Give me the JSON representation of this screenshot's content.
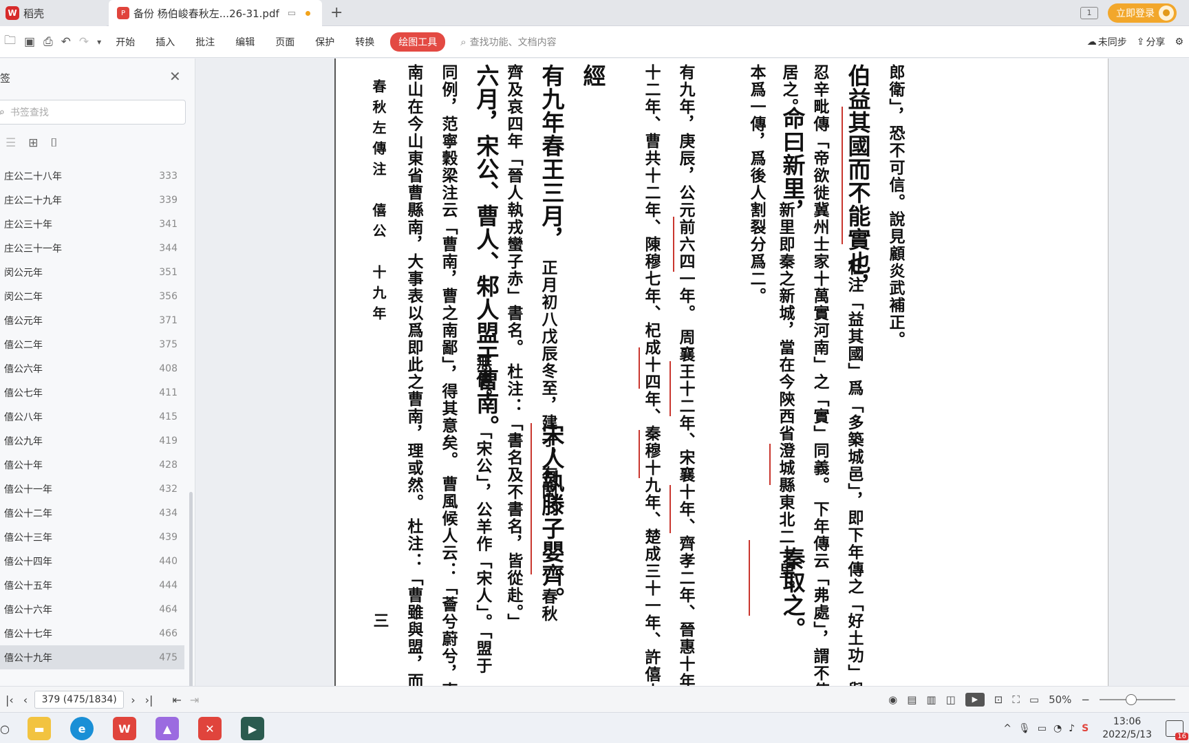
{
  "tabs": {
    "home": "稻壳",
    "doc": "备份 杨伯峻春秋左...26-31.pdf"
  },
  "topright": {
    "page_indicator": "1",
    "login": "立即登录"
  },
  "toolbar": {
    "menus": [
      "开始",
      "插入",
      "批注",
      "编辑",
      "页面",
      "保护",
      "转换"
    ],
    "active": "绘图工具",
    "search_placeholder": "查找功能、文档内容",
    "sync": "未同步",
    "share": "分享"
  },
  "sidebar": {
    "title": "签",
    "search_placeholder": "书签查找",
    "items": [
      {
        "label": "庄公二十八年",
        "page": "333"
      },
      {
        "label": "庄公二十九年",
        "page": "339"
      },
      {
        "label": "庄公三十年",
        "page": "341"
      },
      {
        "label": "庄公三十一年",
        "page": "344"
      },
      {
        "label": "闵公元年",
        "page": "351"
      },
      {
        "label": "闵公二年",
        "page": "356"
      },
      {
        "label": "僖公元年",
        "page": "371"
      },
      {
        "label": "僖公二年",
        "page": "375"
      },
      {
        "label": "僖公六年",
        "page": "408"
      },
      {
        "label": "僖公七年",
        "page": "411"
      },
      {
        "label": "僖公八年",
        "page": "415"
      },
      {
        "label": "僖公九年",
        "page": "419"
      },
      {
        "label": "僖公十年",
        "page": "428"
      },
      {
        "label": "僖公十一年",
        "page": "432"
      },
      {
        "label": "僖公十二年",
        "page": "434"
      },
      {
        "label": "僖公十三年",
        "page": "439"
      },
      {
        "label": "僖公十四年",
        "page": "440"
      },
      {
        "label": "僖公十五年",
        "page": "444"
      },
      {
        "label": "僖公十六年",
        "page": "464"
      },
      {
        "label": "僖公十七年",
        "page": "466"
      },
      {
        "label": "僖公十九年",
        "page": "475"
      }
    ]
  },
  "document": {
    "columns": [
      {
        "text": "郎衛」，恐不可信。說見顧炎武補正。",
        "size": "sml"
      },
      {
        "text": "伯益其國而不能實也，",
        "size": "big"
      },
      {
        "text": "杜注「益其國」爲「多築城邑」，即下年傳之「好土功」與「亟",
        "size": "sml"
      },
      {
        "text": "忍辛毗傳「帝欲徙冀州士家十萬實河南」之「實」同義。 下年傳云「弗處」，謂不使民居之，",
        "size": "sml"
      },
      {
        "text": "居之。",
        "size": "sml"
      },
      {
        "text": "命曰新里，",
        "size": "big"
      },
      {
        "text": "新里即秦之新城，當在今陝西省澄城縣東北二十里。",
        "size": "sml"
      },
      {
        "text": "秦取之。",
        "size": "big"
      },
      {
        "text": "本爲一傳，爲後人割裂分爲二。",
        "size": "sml"
      },
      {
        "text": "有九年，庚辰，公元前六四一年。 周襄王十二年、宋襄十年、齊孝二年、晉惠十年、衛文十",
        "size": "sml"
      },
      {
        "text": "十二年、曹共十二年、陳穆七年、杞成十四年、秦穆十九年、楚成三十一年、許僖十五年。",
        "size": "sml"
      },
      {
        "text": "經",
        "size": "big"
      },
      {
        "text": "有九年春王三月，",
        "size": "big"
      },
      {
        "text": "正月初八戊辰冬至，建子，有閏。",
        "size": "sml"
      },
      {
        "text": "宋人執滕子嬰齊。",
        "size": "big"
      },
      {
        "text": "春秋",
        "size": "sml"
      },
      {
        "text": "齊及哀四年「晉人執戎蠻子赤」書名。 杜注：「書名及不書名，皆從赴。」",
        "size": "sml"
      },
      {
        "text": "六月，宋公、曹人、邾人盟于曹南。",
        "size": "big"
      },
      {
        "text": "無傳。",
        "size": "sml"
      },
      {
        "text": "「宋公」，公羊作「宋人」。「盟于",
        "size": "sml"
      },
      {
        "text": "同例，范寧穀梁注云「曹南，曹之南鄙」，得其意矣。 曹風候人云：「薈兮蔚兮，南山朝隮",
        "size": "sml"
      },
      {
        "text": "南山在今山東省曹縣南，大事表以爲即此之曹南，理或然。 杜注：「曹雖與盟，而猶不服",
        "size": "sml"
      },
      {
        "text": "春秋左傳注　僖公　十九年",
        "size": "hdr"
      },
      {
        "text": "三",
        "size": "sml"
      }
    ]
  },
  "statusbar": {
    "page_field": "379 (475/1834)",
    "zoom": "50%"
  },
  "taskbar": {
    "time": "13:06",
    "date": "2022/5/13",
    "notif_count": "16"
  }
}
